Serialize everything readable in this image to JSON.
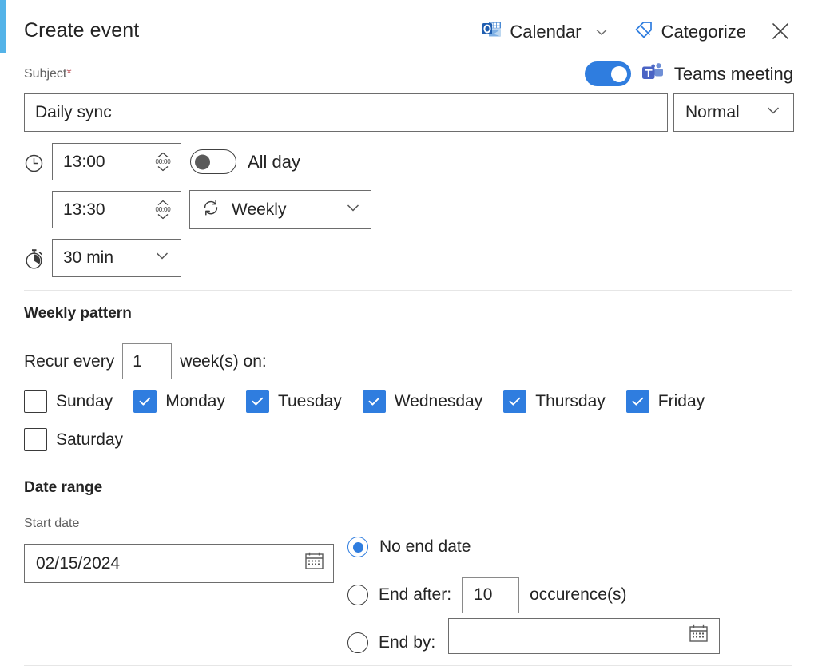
{
  "header": {
    "title": "Create event",
    "calendar_button": "Calendar",
    "categorize_button": "Categorize",
    "close_label": "Close"
  },
  "subject": {
    "label": "Subject",
    "required_mark": "*",
    "value": "Daily sync"
  },
  "priority": {
    "value": "Normal"
  },
  "teams": {
    "label": "Teams meeting",
    "enabled": true
  },
  "time": {
    "start": "13:00",
    "end": "13:30",
    "spinner_hint": "00:00",
    "duration": "30 min",
    "all_day_label": "All day",
    "all_day_enabled": false,
    "recurrence": "Weekly"
  },
  "weekly_pattern": {
    "heading": "Weekly pattern",
    "recur_every_label": "Recur every",
    "interval": "1",
    "weeks_on_label": "week(s) on:",
    "days": [
      {
        "label": "Sunday",
        "checked": false
      },
      {
        "label": "Monday",
        "checked": true
      },
      {
        "label": "Tuesday",
        "checked": true
      },
      {
        "label": "Wednesday",
        "checked": true
      },
      {
        "label": "Thursday",
        "checked": true
      },
      {
        "label": "Friday",
        "checked": true
      },
      {
        "label": "Saturday",
        "checked": false
      }
    ]
  },
  "date_range": {
    "heading": "Date range",
    "start_date_label": "Start date",
    "start_date_value": "02/15/2024",
    "no_end_date_label": "No end date",
    "end_after_label": "End after:",
    "occurrences_value": "10",
    "occurrences_label": "occurence(s)",
    "end_by_label": "End by:",
    "end_by_value": "",
    "selected_option": "no_end_date"
  },
  "colors": {
    "accent_bar": "#54b3e8",
    "brand_blue": "#2f7ddf",
    "required_red": "#c4636a",
    "border": "#6d6d6d",
    "divider": "#e6e6e6"
  },
  "icons": {
    "calendar": "outlook-calendar-icon",
    "categorize": "tag-icon",
    "close": "close-icon",
    "teams": "teams-icon",
    "clock": "clock-icon",
    "timer": "timer-icon",
    "recurrence": "recurrence-icon",
    "date_picker": "calendar-picker-icon"
  }
}
